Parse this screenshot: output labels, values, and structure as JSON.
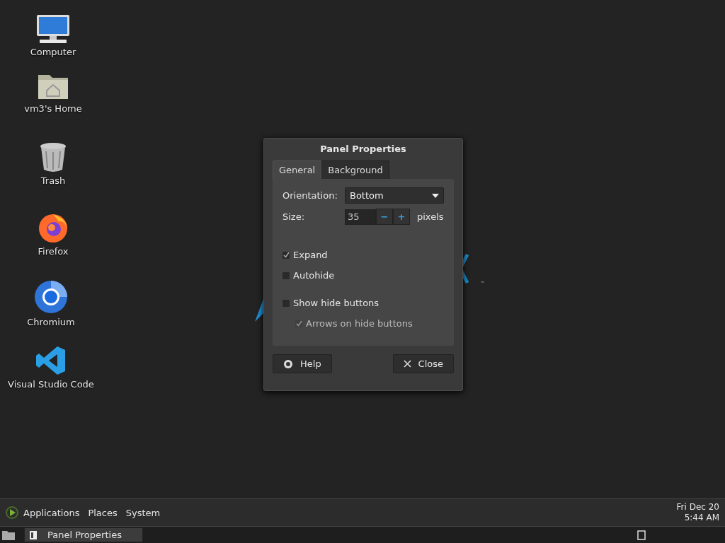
{
  "desktop_icons": [
    {
      "kind": "computer",
      "label": "Computer"
    },
    {
      "kind": "home",
      "label": "vm3's Home"
    },
    {
      "kind": "trash",
      "label": "Trash"
    },
    {
      "kind": "firefox",
      "label": "Firefox"
    },
    {
      "kind": "chromium",
      "label": "Chromium"
    },
    {
      "kind": "vscode",
      "label": "Visual Studio Code"
    }
  ],
  "wallpaper_mark": "™",
  "dialog": {
    "title": "Panel Properties",
    "tabs": [
      {
        "label": "General",
        "selected": true
      },
      {
        "label": "Background",
        "selected": false
      }
    ],
    "orientation": {
      "label": "Orientation:",
      "value": "Bottom"
    },
    "size": {
      "label": "Size:",
      "value": "35",
      "unit": "pixels",
      "minus": "−",
      "plus": "+"
    },
    "options": [
      {
        "label": "Expand",
        "checked": true,
        "disabled": false
      },
      {
        "label": "Autohide",
        "checked": false,
        "disabled": false
      },
      {
        "label": "Show hide buttons",
        "checked": false,
        "disabled": false,
        "children": [
          {
            "label": "Arrows on hide buttons",
            "checked": true,
            "disabled": true
          }
        ]
      }
    ],
    "buttons": [
      {
        "kind": "help",
        "label": "Help"
      },
      {
        "kind": "close",
        "label": "Close"
      }
    ]
  },
  "top_panel": {
    "menus": [
      "Applications",
      "Places",
      "System"
    ],
    "date": "Fri Dec 20",
    "time": "5:44 AM"
  },
  "bottom_panel": {
    "tasks": [
      {
        "label": "Panel Properties",
        "selected": true
      }
    ]
  }
}
